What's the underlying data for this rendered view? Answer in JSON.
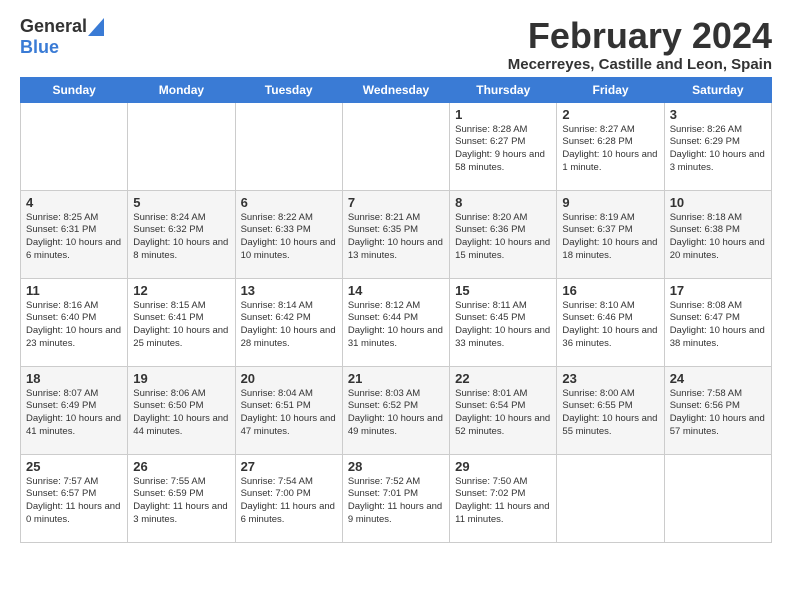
{
  "logo": {
    "general": "General",
    "blue": "Blue"
  },
  "title": "February 2024",
  "subtitle": "Mecerreyes, Castille and Leon, Spain",
  "days_of_week": [
    "Sunday",
    "Monday",
    "Tuesday",
    "Wednesday",
    "Thursday",
    "Friday",
    "Saturday"
  ],
  "weeks": [
    [
      {
        "day": "",
        "content": ""
      },
      {
        "day": "",
        "content": ""
      },
      {
        "day": "",
        "content": ""
      },
      {
        "day": "",
        "content": ""
      },
      {
        "day": "1",
        "content": "Sunrise: 8:28 AM\nSunset: 6:27 PM\nDaylight: 9 hours\nand 58 minutes."
      },
      {
        "day": "2",
        "content": "Sunrise: 8:27 AM\nSunset: 6:28 PM\nDaylight: 10 hours\nand 1 minute."
      },
      {
        "day": "3",
        "content": "Sunrise: 8:26 AM\nSunset: 6:29 PM\nDaylight: 10 hours\nand 3 minutes."
      }
    ],
    [
      {
        "day": "4",
        "content": "Sunrise: 8:25 AM\nSunset: 6:31 PM\nDaylight: 10 hours\nand 6 minutes."
      },
      {
        "day": "5",
        "content": "Sunrise: 8:24 AM\nSunset: 6:32 PM\nDaylight: 10 hours\nand 8 minutes."
      },
      {
        "day": "6",
        "content": "Sunrise: 8:22 AM\nSunset: 6:33 PM\nDaylight: 10 hours\nand 10 minutes."
      },
      {
        "day": "7",
        "content": "Sunrise: 8:21 AM\nSunset: 6:35 PM\nDaylight: 10 hours\nand 13 minutes."
      },
      {
        "day": "8",
        "content": "Sunrise: 8:20 AM\nSunset: 6:36 PM\nDaylight: 10 hours\nand 15 minutes."
      },
      {
        "day": "9",
        "content": "Sunrise: 8:19 AM\nSunset: 6:37 PM\nDaylight: 10 hours\nand 18 minutes."
      },
      {
        "day": "10",
        "content": "Sunrise: 8:18 AM\nSunset: 6:38 PM\nDaylight: 10 hours\nand 20 minutes."
      }
    ],
    [
      {
        "day": "11",
        "content": "Sunrise: 8:16 AM\nSunset: 6:40 PM\nDaylight: 10 hours\nand 23 minutes."
      },
      {
        "day": "12",
        "content": "Sunrise: 8:15 AM\nSunset: 6:41 PM\nDaylight: 10 hours\nand 25 minutes."
      },
      {
        "day": "13",
        "content": "Sunrise: 8:14 AM\nSunset: 6:42 PM\nDaylight: 10 hours\nand 28 minutes."
      },
      {
        "day": "14",
        "content": "Sunrise: 8:12 AM\nSunset: 6:44 PM\nDaylight: 10 hours\nand 31 minutes."
      },
      {
        "day": "15",
        "content": "Sunrise: 8:11 AM\nSunset: 6:45 PM\nDaylight: 10 hours\nand 33 minutes."
      },
      {
        "day": "16",
        "content": "Sunrise: 8:10 AM\nSunset: 6:46 PM\nDaylight: 10 hours\nand 36 minutes."
      },
      {
        "day": "17",
        "content": "Sunrise: 8:08 AM\nSunset: 6:47 PM\nDaylight: 10 hours\nand 38 minutes."
      }
    ],
    [
      {
        "day": "18",
        "content": "Sunrise: 8:07 AM\nSunset: 6:49 PM\nDaylight: 10 hours\nand 41 minutes."
      },
      {
        "day": "19",
        "content": "Sunrise: 8:06 AM\nSunset: 6:50 PM\nDaylight: 10 hours\nand 44 minutes."
      },
      {
        "day": "20",
        "content": "Sunrise: 8:04 AM\nSunset: 6:51 PM\nDaylight: 10 hours\nand 47 minutes."
      },
      {
        "day": "21",
        "content": "Sunrise: 8:03 AM\nSunset: 6:52 PM\nDaylight: 10 hours\nand 49 minutes."
      },
      {
        "day": "22",
        "content": "Sunrise: 8:01 AM\nSunset: 6:54 PM\nDaylight: 10 hours\nand 52 minutes."
      },
      {
        "day": "23",
        "content": "Sunrise: 8:00 AM\nSunset: 6:55 PM\nDaylight: 10 hours\nand 55 minutes."
      },
      {
        "day": "24",
        "content": "Sunrise: 7:58 AM\nSunset: 6:56 PM\nDaylight: 10 hours\nand 57 minutes."
      }
    ],
    [
      {
        "day": "25",
        "content": "Sunrise: 7:57 AM\nSunset: 6:57 PM\nDaylight: 11 hours\nand 0 minutes."
      },
      {
        "day": "26",
        "content": "Sunrise: 7:55 AM\nSunset: 6:59 PM\nDaylight: 11 hours\nand 3 minutes."
      },
      {
        "day": "27",
        "content": "Sunrise: 7:54 AM\nSunset: 7:00 PM\nDaylight: 11 hours\nand 6 minutes."
      },
      {
        "day": "28",
        "content": "Sunrise: 7:52 AM\nSunset: 7:01 PM\nDaylight: 11 hours\nand 9 minutes."
      },
      {
        "day": "29",
        "content": "Sunrise: 7:50 AM\nSunset: 7:02 PM\nDaylight: 11 hours\nand 11 minutes."
      },
      {
        "day": "",
        "content": ""
      },
      {
        "day": "",
        "content": ""
      }
    ]
  ]
}
